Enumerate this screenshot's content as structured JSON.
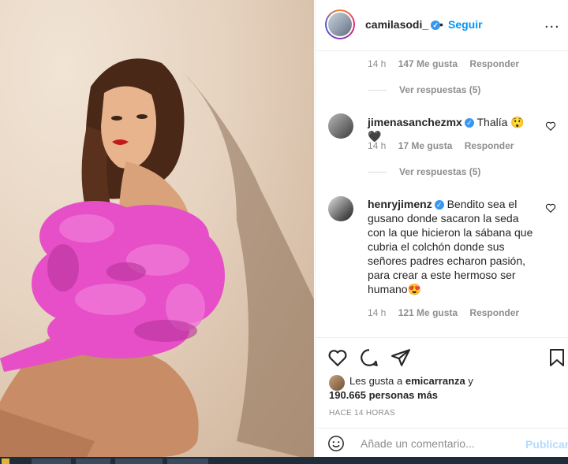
{
  "post": {
    "username": "camilasodi_",
    "separator": "•",
    "follow_label": "Seguir",
    "more_label": "..."
  },
  "comments": {
    "first_meta": {
      "time": "14 h",
      "likes": "147 Me gusta",
      "reply": "Responder"
    },
    "first_replies": "Ver respuestas (5)",
    "items": [
      {
        "username": "jimenasanchezmx",
        "text": "Thalía 😲🖤",
        "time": "14 h",
        "likes": "17 Me gusta",
        "reply": "Responder",
        "replies": "Ver respuestas (5)"
      },
      {
        "username": "henryjimenz",
        "text": "Bendito sea el gusano donde sacaron la seda con la que hicieron la sábana que cubria el colchón donde sus señores padres echaron pasión, para crear a este hermoso ser humano😍",
        "time": "14 h",
        "likes": "121 Me gusta",
        "reply": "Responder"
      }
    ]
  },
  "likes": {
    "prefix": "Les gusta a",
    "user": "emicarranza",
    "and": "y",
    "count": "190.665 personas más"
  },
  "timestamp": "HACE 14 HORAS",
  "add_comment": {
    "placeholder": "Añade un comentario...",
    "publish_label": "Publicar"
  },
  "icons": [
    "heart-icon",
    "comment-icon",
    "share-icon",
    "bookmark-icon",
    "emoji-icon",
    "verified-icon"
  ],
  "colors": {
    "accent": "#0095f6",
    "publish_disabled": "#b3dbff",
    "muted": "#8e8e8e",
    "text": "#262626",
    "dress": "#e64fc7"
  }
}
